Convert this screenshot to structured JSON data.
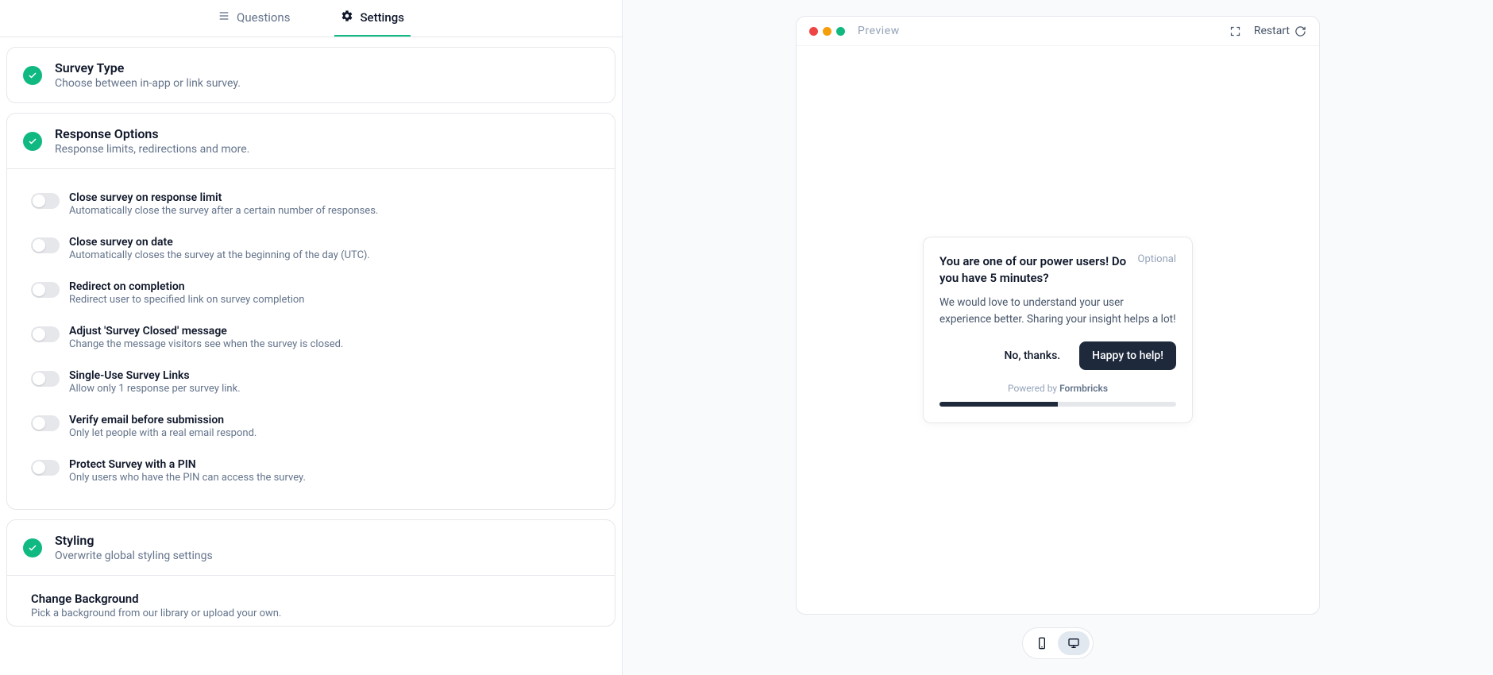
{
  "tabs": {
    "questions": "Questions",
    "settings": "Settings"
  },
  "cards": {
    "surveyType": {
      "title": "Survey Type",
      "sub": "Choose between in-app or link survey."
    },
    "responseOptions": {
      "title": "Response Options",
      "sub": "Response limits, redirections and more.",
      "items": [
        {
          "title": "Close survey on response limit",
          "sub": "Automatically close the survey after a certain number of responses."
        },
        {
          "title": "Close survey on date",
          "sub": "Automatically closes the survey at the beginning of the day (UTC)."
        },
        {
          "title": "Redirect on completion",
          "sub": "Redirect user to specified link on survey completion"
        },
        {
          "title": "Adjust 'Survey Closed' message",
          "sub": "Change the message visitors see when the survey is closed."
        },
        {
          "title": "Single-Use Survey Links",
          "sub": "Allow only 1 response per survey link."
        },
        {
          "title": "Verify email before submission",
          "sub": "Only let people with a real email respond."
        },
        {
          "title": "Protect Survey with a PIN",
          "sub": "Only users who have the PIN can access the survey."
        }
      ]
    },
    "styling": {
      "title": "Styling",
      "sub": "Overwrite global styling settings",
      "bg": {
        "title": "Change Background",
        "sub": "Pick a background from our library or upload your own."
      }
    }
  },
  "preview": {
    "label": "Preview",
    "restart": "Restart",
    "survey": {
      "title": "You are one of our power users! Do you have 5 minutes?",
      "optional": "Optional",
      "desc": "We would love to understand your user experience better. Sharing your insight helps a lot!",
      "secondary": "No, thanks.",
      "primary": "Happy to help!",
      "powered_prefix": "Powered by ",
      "powered_brand": "Formbricks",
      "progress_pct": 50
    }
  }
}
